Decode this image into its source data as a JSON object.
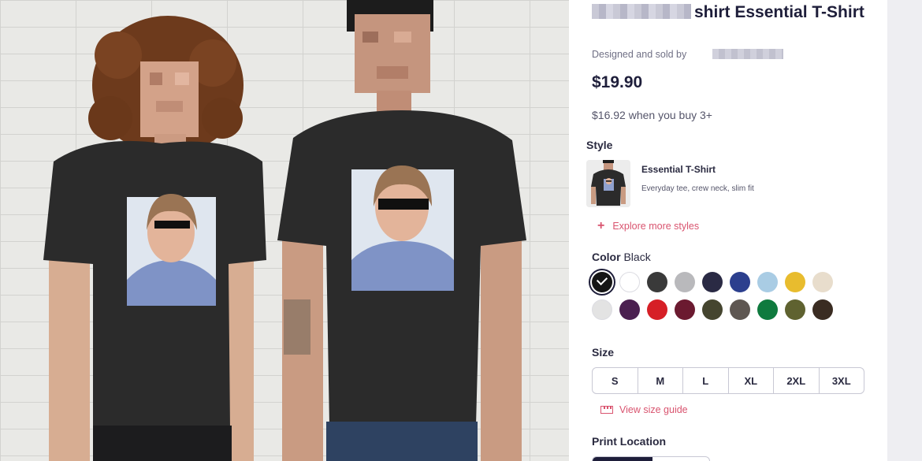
{
  "product": {
    "title_suffix": "shirt Essential T-Shirt",
    "designed_by_label": "Designed and sold by",
    "price": "$19.90",
    "bulk_offer": "$16.92 when you buy 3+"
  },
  "style": {
    "heading": "Style",
    "name": "Essential T-Shirt",
    "description": "Everyday tee, crew neck, slim fit",
    "explore_label": "Explore more styles"
  },
  "color": {
    "heading": "Color",
    "selected": "Black",
    "swatches": [
      "#161616",
      "#ffffff",
      "#3a3a3a",
      "#b9b9bc",
      "#2a2a44",
      "#2c3f8e",
      "#a9cce4",
      "#e8bc2e",
      "#e8ddcc",
      "#e3e3e3",
      "#4b2050",
      "#d61f26",
      "#6b1a30",
      "#45452f",
      "#5e5752",
      "#0f7a3e",
      "#5f6230",
      "#3a2c22"
    ]
  },
  "size": {
    "heading": "Size",
    "options": [
      "S",
      "M",
      "L",
      "XL",
      "2XL",
      "3XL"
    ],
    "guide_label": "View size guide"
  },
  "print": {
    "heading": "Print Location"
  }
}
